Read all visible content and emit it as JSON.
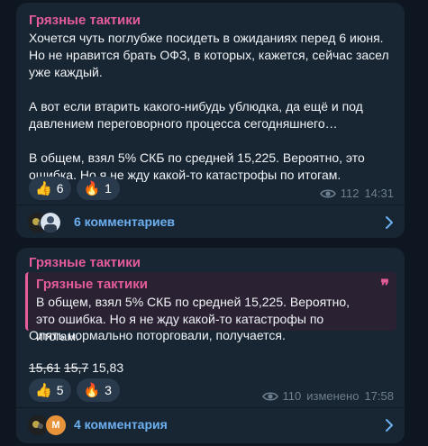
{
  "colors": {
    "background": "#0e1621",
    "bubble": "#182533",
    "author": "#e45c9a",
    "text": "#f0f3f6",
    "meta": "#6d7f8f",
    "link": "#6cb0f0"
  },
  "posts": [
    {
      "author": "Грязные тактики",
      "text": "Хочется чуть поглубже посидеть в ожиданиях перед 6 июня. Но не нравится брать ОФЗ, в которых, кажется, сейчас засел уже каждый.\n\nА вот если втарить какого-нибудь ублюдка, да ещё и под давлением переговорного процесса сегодняшнего…\n\nВ общем, взял 5% СКБ по средней 15,225. Вероятно, это ошибка. Но я не жду какой-то катастрофы по итогам.",
      "reactions": [
        {
          "icon": "thumbs-up-icon",
          "emoji": "👍",
          "count": "6"
        },
        {
          "icon": "fire-icon",
          "emoji": "🔥",
          "count": "1"
        }
      ],
      "views": "112",
      "time": "14:31",
      "comments": "6 комментариев"
    },
    {
      "author": "Грязные тактики",
      "quote": {
        "author": "Грязные тактики",
        "text": "В общем, взял 5% СКБ по средней 15,225. Вероятно, это ошибка. Но я не жду какой-то катастрофы по итогам.",
        "mark": "❞"
      },
      "text": "Опять нормально поторговали, получается.",
      "prices": {
        "old1": "15,61",
        "old2": "15,7",
        "current": "15,83"
      },
      "reactions": [
        {
          "icon": "thumbs-up-icon",
          "emoji": "👍",
          "count": "5"
        },
        {
          "icon": "fire-icon",
          "emoji": "🔥",
          "count": "3"
        }
      ],
      "views": "110",
      "edited": "изменено",
      "time": "17:58",
      "comments": "4 комментария",
      "avatar_letter": "M"
    }
  ]
}
